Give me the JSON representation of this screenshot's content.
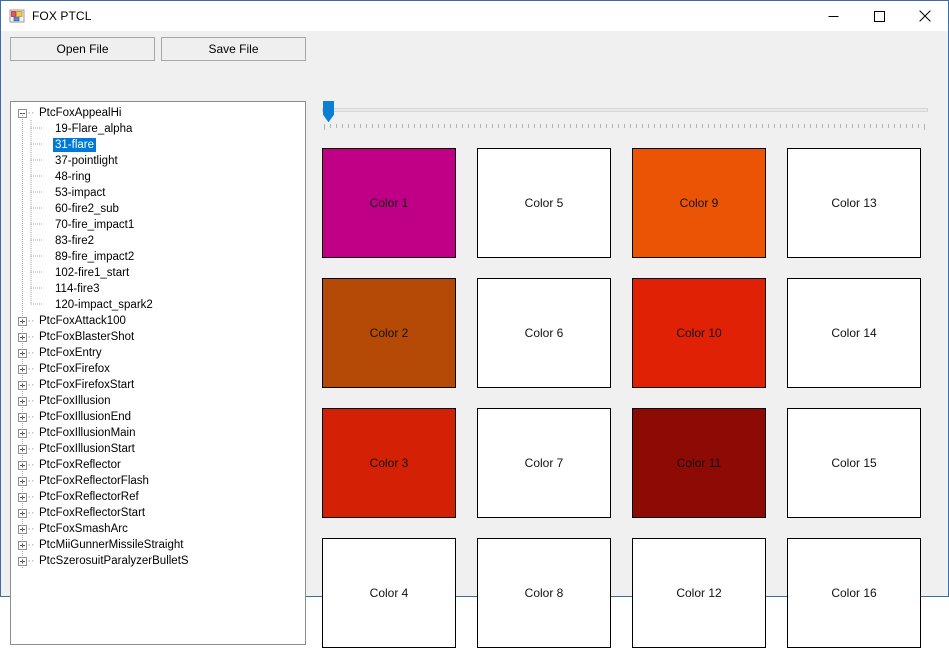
{
  "window": {
    "title": "FOX PTCL",
    "icon": "windows-forms-app-icon",
    "background_color": "#f0f0f0",
    "border_color": "#3a6ea5",
    "caption_buttons": [
      {
        "name": "minimize",
        "glyph": "minimize-icon"
      },
      {
        "name": "maximize",
        "glyph": "maximize-icon"
      },
      {
        "name": "close",
        "glyph": "close-icon"
      }
    ]
  },
  "toolbar": {
    "open_file_label": "Open File",
    "save_file_label": "Save File"
  },
  "trackbar": {
    "name": "frame-slider",
    "value": 0,
    "min": 0,
    "max": 100,
    "thumb_color": "#0b7fd4",
    "tick_count": 101
  },
  "tree": {
    "selected": "31-flare",
    "nodes": [
      {
        "label": "PtcFoxAppealHi",
        "expanded": true,
        "level": 0
      },
      {
        "label": "19-Flare_alpha",
        "level": 1
      },
      {
        "label": "31-flare",
        "level": 1,
        "selected": true
      },
      {
        "label": "37-pointlight",
        "level": 1
      },
      {
        "label": "48-ring",
        "level": 1
      },
      {
        "label": "53-impact",
        "level": 1
      },
      {
        "label": "60-fire2_sub",
        "level": 1
      },
      {
        "label": "70-fire_impact1",
        "level": 1
      },
      {
        "label": "83-fire2",
        "level": 1
      },
      {
        "label": "89-fire_impact2",
        "level": 1
      },
      {
        "label": "102-fire1_start",
        "level": 1
      },
      {
        "label": "114-fire3",
        "level": 1
      },
      {
        "label": "120-impact_spark2",
        "level": 1
      },
      {
        "label": "PtcFoxAttack100",
        "expanded": false,
        "level": 0
      },
      {
        "label": "PtcFoxBlasterShot",
        "expanded": false,
        "level": 0
      },
      {
        "label": "PtcFoxEntry",
        "expanded": false,
        "level": 0
      },
      {
        "label": "PtcFoxFirefox",
        "expanded": false,
        "level": 0
      },
      {
        "label": "PtcFoxFirefoxStart",
        "expanded": false,
        "level": 0
      },
      {
        "label": "PtcFoxIllusion",
        "expanded": false,
        "level": 0
      },
      {
        "label": "PtcFoxIllusionEnd",
        "expanded": false,
        "level": 0
      },
      {
        "label": "PtcFoxIllusionMain",
        "expanded": false,
        "level": 0
      },
      {
        "label": "PtcFoxIllusionStart",
        "expanded": false,
        "level": 0
      },
      {
        "label": "PtcFoxReflector",
        "expanded": false,
        "level": 0
      },
      {
        "label": "PtcFoxReflectorFlash",
        "expanded": false,
        "level": 0
      },
      {
        "label": "PtcFoxReflectorRef",
        "expanded": false,
        "level": 0
      },
      {
        "label": "PtcFoxReflectorStart",
        "expanded": false,
        "level": 0
      },
      {
        "label": "PtcFoxSmashArc",
        "expanded": false,
        "level": 0
      },
      {
        "label": "PtcMiiGunnerMissileStraight",
        "expanded": false,
        "level": 0
      },
      {
        "label": "PtcSzerosuitParalyzerBulletS",
        "expanded": false,
        "level": 0
      }
    ]
  },
  "swatches": [
    {
      "label": "Color 1",
      "color": "#bf0087"
    },
    {
      "label": "Color 5",
      "color": "#ffffff"
    },
    {
      "label": "Color 9",
      "color": "#eb5405"
    },
    {
      "label": "Color 13",
      "color": "#ffffff"
    },
    {
      "label": "Color 2",
      "color": "#b54a06"
    },
    {
      "label": "Color 6",
      "color": "#ffffff"
    },
    {
      "label": "Color 10",
      "color": "#e02105"
    },
    {
      "label": "Color 14",
      "color": "#ffffff"
    },
    {
      "label": "Color 3",
      "color": "#d42105"
    },
    {
      "label": "Color 7",
      "color": "#ffffff"
    },
    {
      "label": "Color 11",
      "color": "#8e0b05"
    },
    {
      "label": "Color 15",
      "color": "#ffffff"
    },
    {
      "label": "Color 4",
      "color": "#ffffff"
    },
    {
      "label": "Color 8",
      "color": "#ffffff"
    },
    {
      "label": "Color 12",
      "color": "#ffffff"
    },
    {
      "label": "Color 16",
      "color": "#ffffff"
    }
  ]
}
